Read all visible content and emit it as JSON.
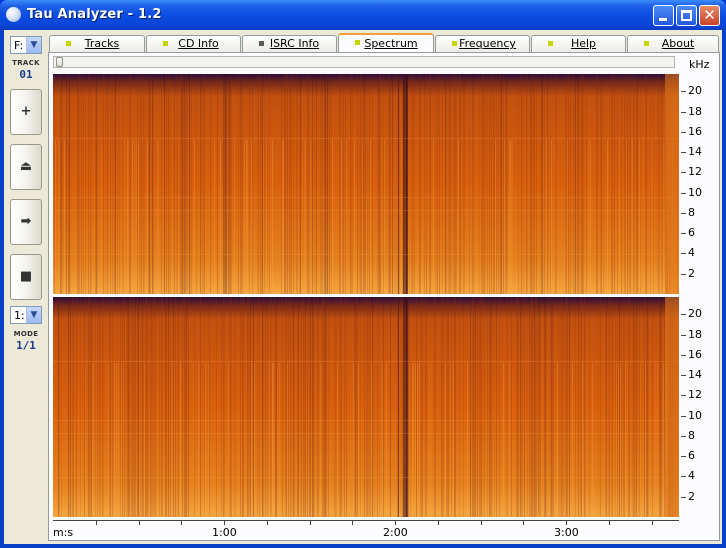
{
  "window": {
    "title": "Tau Analyzer - 1.2",
    "close_glyph": "✕"
  },
  "leftbar": {
    "drive_value": "F:",
    "track_label": "TRACK",
    "track_number": "01",
    "buttons": [
      {
        "name": "add-icon",
        "glyph": "+"
      },
      {
        "name": "eject-icon",
        "glyph": "⏏"
      },
      {
        "name": "play-icon",
        "glyph": "➡"
      },
      {
        "name": "stop-icon",
        "glyph": "■"
      }
    ],
    "mode_value": "1:",
    "mode_label": "MODE",
    "mode_number": "1/1"
  },
  "tabs": [
    {
      "label": "Tracks",
      "led": "#c8d400",
      "active": false
    },
    {
      "label": "CD Info",
      "led": "#c8d400",
      "active": false
    },
    {
      "label": "ISRC Info",
      "led": "#5a5a5a",
      "active": false
    },
    {
      "label": "Spectrum",
      "led": "#c8d400",
      "active": true
    },
    {
      "label": "Frequency",
      "led": "#c8d400",
      "active": false
    },
    {
      "label": "Help",
      "led": "#c8d400",
      "active": false
    },
    {
      "label": "About",
      "led": "#c8d400",
      "active": false
    }
  ],
  "spectrum": {
    "freq_unit": "kHz",
    "freq_ticks": [
      "20",
      "18",
      "16",
      "14",
      "12",
      "10",
      "8",
      "6",
      "4",
      "2"
    ],
    "time_axis_label": "m:s",
    "time_ticks": [
      "1:00",
      "2:00",
      "3:00"
    ],
    "colors": {
      "hot": "#f4a640",
      "mid": "#d9610d",
      "dark": "#2a0c3a"
    }
  }
}
